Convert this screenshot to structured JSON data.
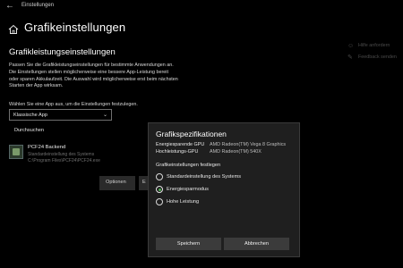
{
  "window": {
    "title": "Einstellungen"
  },
  "header": {
    "title": "Grafikeinstellungen"
  },
  "main": {
    "section_title": "Grafikleistungseinstellungen",
    "description": "Passen Sie die Grafikleistungseinstellungen für bestimmte Anwendungen an. Die Einstellungen stellen möglicherweise eine bessere App-Leistung bereit oder sparen Akkulaufzeit. Die Auswahl wird möglicherweise erst beim nächsten Starten der App wirksam.",
    "choose_label": "Wählen Sie eine App aus, um die Einstellungen festzulegen.",
    "app_type_value": "Klassische App",
    "browse_label": "Durchsuchen",
    "app": {
      "name": "PCF24 Backend",
      "line2": "Standardeinstellung des Systems",
      "line3": "C:\\Program Files\\PCF24\\PCF24.exe"
    },
    "options_label": "Optionen",
    "remove_label": "E"
  },
  "side_links": {
    "help": "Hilfe anfordern",
    "feedback": "Feedback senden"
  },
  "dialog": {
    "title": "Grafikspezifikationen",
    "specs": [
      {
        "label": "Energiesparende GPU",
        "value": "AMD Radeon(TM) Vega 8 Graphics"
      },
      {
        "label": "Hochleistungs-GPU",
        "value": "AMD Radeon(TM) 540X"
      }
    ],
    "settings_label": "Grafikeinstellungen festlegen",
    "options": [
      {
        "label": "Standardeinstellung des Systems",
        "selected": false
      },
      {
        "label": "Energiesparmodus",
        "selected": true
      },
      {
        "label": "Hohe Leistung",
        "selected": false
      }
    ],
    "save_label": "Speichern",
    "cancel_label": "Abbrechen"
  },
  "colors": {
    "accent": "#4caf50",
    "background": "#000000",
    "dialog": "#1f1f1f",
    "button": "#3b3b3b"
  },
  "icons": {
    "back": "back-arrow-icon",
    "home": "home-icon",
    "help": "help-icon",
    "feedback": "feedback-icon",
    "dropdown": "chevron-down-icon"
  }
}
